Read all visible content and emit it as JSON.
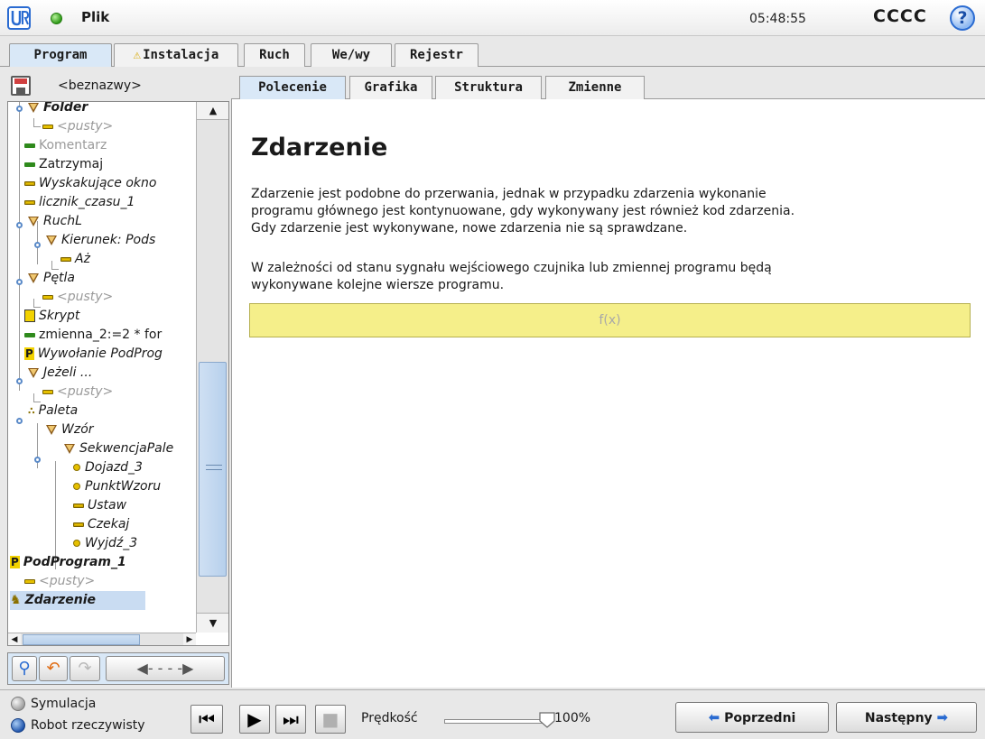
{
  "topbar": {
    "file_menu": "Plik",
    "time": "05:48:55",
    "robot_name": "CCCC",
    "help": "?"
  },
  "main_tabs": [
    {
      "label": "Program",
      "active": true
    },
    {
      "label": "Instalacja",
      "active": false,
      "warning": true
    },
    {
      "label": "Ruch",
      "active": false
    },
    {
      "label": "We/wy",
      "active": false
    },
    {
      "label": "Rejestr",
      "active": false
    }
  ],
  "program": {
    "name": "<beznazwy>"
  },
  "tree": {
    "items": [
      {
        "label": "Folder",
        "icon": "folder-icon"
      },
      {
        "label": "<pusty>",
        "icon": "empty-icon"
      },
      {
        "label": "Komentarz",
        "icon": "comment-icon"
      },
      {
        "label": "Zatrzymaj",
        "icon": "halt-icon"
      },
      {
        "label": "Wyskakujące okno",
        "icon": "popup-icon"
      },
      {
        "label": "licznik_czasu_1",
        "icon": "timer-icon"
      },
      {
        "label": "RuchL",
        "icon": "move-icon"
      },
      {
        "label": "Kierunek: Pods",
        "icon": "direction-icon"
      },
      {
        "label": "Aż",
        "icon": "until-icon"
      },
      {
        "label": "Pętla",
        "icon": "loop-icon"
      },
      {
        "label": "<pusty>",
        "icon": "empty-icon"
      },
      {
        "label": "Skrypt",
        "icon": "script-icon"
      },
      {
        "label": "zmienna_2:=2 * for",
        "icon": "assignment-icon"
      },
      {
        "label": "Wywołanie PodProg",
        "icon": "call-icon"
      },
      {
        "label": "Jeżeli ...",
        "icon": "if-icon"
      },
      {
        "label": "<pusty>",
        "icon": "empty-icon"
      },
      {
        "label": "Paleta",
        "icon": "pallet-icon"
      },
      {
        "label": "Wzór",
        "icon": "pattern-icon"
      },
      {
        "label": "SekwencjaPale",
        "icon": "sequence-icon"
      },
      {
        "label": "Dojazd_3",
        "icon": "waypoint-icon"
      },
      {
        "label": "PunktWzoru",
        "icon": "waypoint-icon"
      },
      {
        "label": "Ustaw",
        "icon": "set-icon"
      },
      {
        "label": "Czekaj",
        "icon": "wait-icon"
      },
      {
        "label": "Wyjdź_3",
        "icon": "waypoint-icon"
      },
      {
        "label": "PodProgram_1",
        "icon": "subprogram-icon"
      },
      {
        "label": "<pusty>",
        "icon": "empty-icon"
      },
      {
        "label": "Zdarzenie",
        "icon": "event-icon"
      }
    ]
  },
  "sub_tabs": [
    {
      "label": "Polecenie",
      "active": true
    },
    {
      "label": "Grafika",
      "active": false
    },
    {
      "label": "Struktura",
      "active": false
    },
    {
      "label": "Zmienne",
      "active": false
    }
  ],
  "content": {
    "title": "Zdarzenie",
    "desc1_line1": "Zdarzenie jest podobne do przerwania, jednak w przypadku zdarzenia wykonanie",
    "desc1_line2": "programu głównego jest kontynuowane, gdy wykonywany jest również kod zdarzenia.",
    "desc1_line3": "Gdy zdarzenie jest wykonywane, nowe zdarzenia nie są sprawdzane.",
    "desc2_line1": "W zależności od stanu sygnału wejściowego czujnika lub zmiennej programu będą",
    "desc2_line2": "wykonywane kolejne wiersze programu.",
    "expression_placeholder": "f(x)"
  },
  "footer": {
    "mode_simulation": "Symulacja",
    "mode_real": "Robot rzeczywisty",
    "speed_label": "Prędkość",
    "speed_value": "100%",
    "speed_fraction": 1.0,
    "prev_label": "Poprzedni",
    "next_label": "Następny"
  },
  "colors": {
    "accent": "#2a6bd1",
    "active_tab": "#d9e8f7",
    "expression_bg": "#f5ef8a",
    "status_green": "#2f9a18"
  }
}
